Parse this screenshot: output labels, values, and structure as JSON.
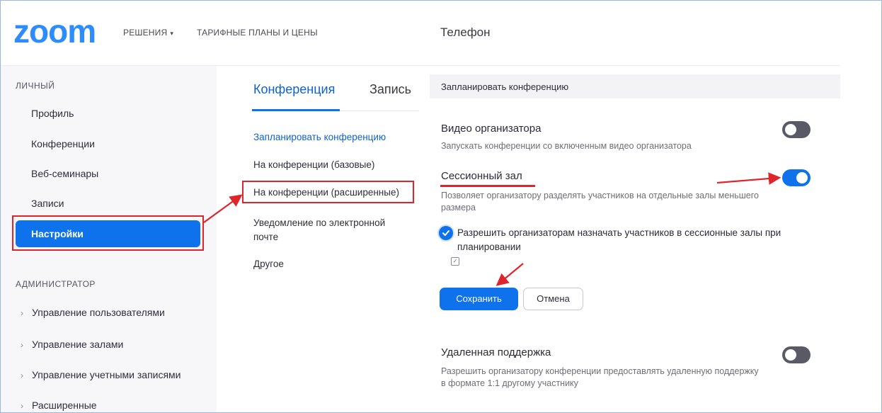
{
  "header": {
    "logo": "zoom",
    "nav_solutions": "РЕШЕНИЯ",
    "nav_plans": "ТАРИФНЫЕ ПЛАНЫ И ЦЕНЫ",
    "nav_phone": "Телефон"
  },
  "sidebar": {
    "personal_label": "ЛИЧНЫЙ",
    "items": [
      {
        "label": "Профиль"
      },
      {
        "label": "Конференции"
      },
      {
        "label": "Веб-семинары"
      },
      {
        "label": "Записи"
      },
      {
        "label": "Настройки",
        "active": true
      }
    ],
    "admin_label": "АДМИНИСТРАТОР",
    "admin_items": [
      {
        "label": "Управление пользователями"
      },
      {
        "label": "Управление залами"
      },
      {
        "label": "Управление учетными записями"
      },
      {
        "label": "Расширенные"
      }
    ]
  },
  "tabs": [
    {
      "label": "Конференция",
      "active": true
    },
    {
      "label": "Запись"
    }
  ],
  "submenu": [
    {
      "label": "Запланировать конференцию",
      "active": true
    },
    {
      "label": "На конференции (базовые)"
    },
    {
      "label": "На конференции (расширенные)"
    },
    {
      "label": "Уведомление по электронной почте"
    },
    {
      "label": "Другое"
    }
  ],
  "content": {
    "section_title": "Запланировать конференцию",
    "host_video": {
      "title": "Видео организатора",
      "desc": "Запускать конференции со включенным видео организатора",
      "enabled": false
    },
    "breakout": {
      "title": "Сессионный зал",
      "desc": "Позволяет организатору разделять участников на отдельные залы меньшего размера",
      "enabled": true,
      "option_label": "Разрешить организаторам назначать участников в сессионные залы при планировании",
      "option_checked": true
    },
    "save_label": "Сохранить",
    "cancel_label": "Отмена",
    "remote_support": {
      "title": "Удаленная поддержка",
      "desc": "Разрешить организатору конференции предоставлять удаленную поддержку в формате 1:1 другому участнику",
      "enabled": false
    }
  },
  "colors": {
    "brand": "#2d8cff",
    "accent": "#0e72ed",
    "annotation": "#e0242b"
  }
}
